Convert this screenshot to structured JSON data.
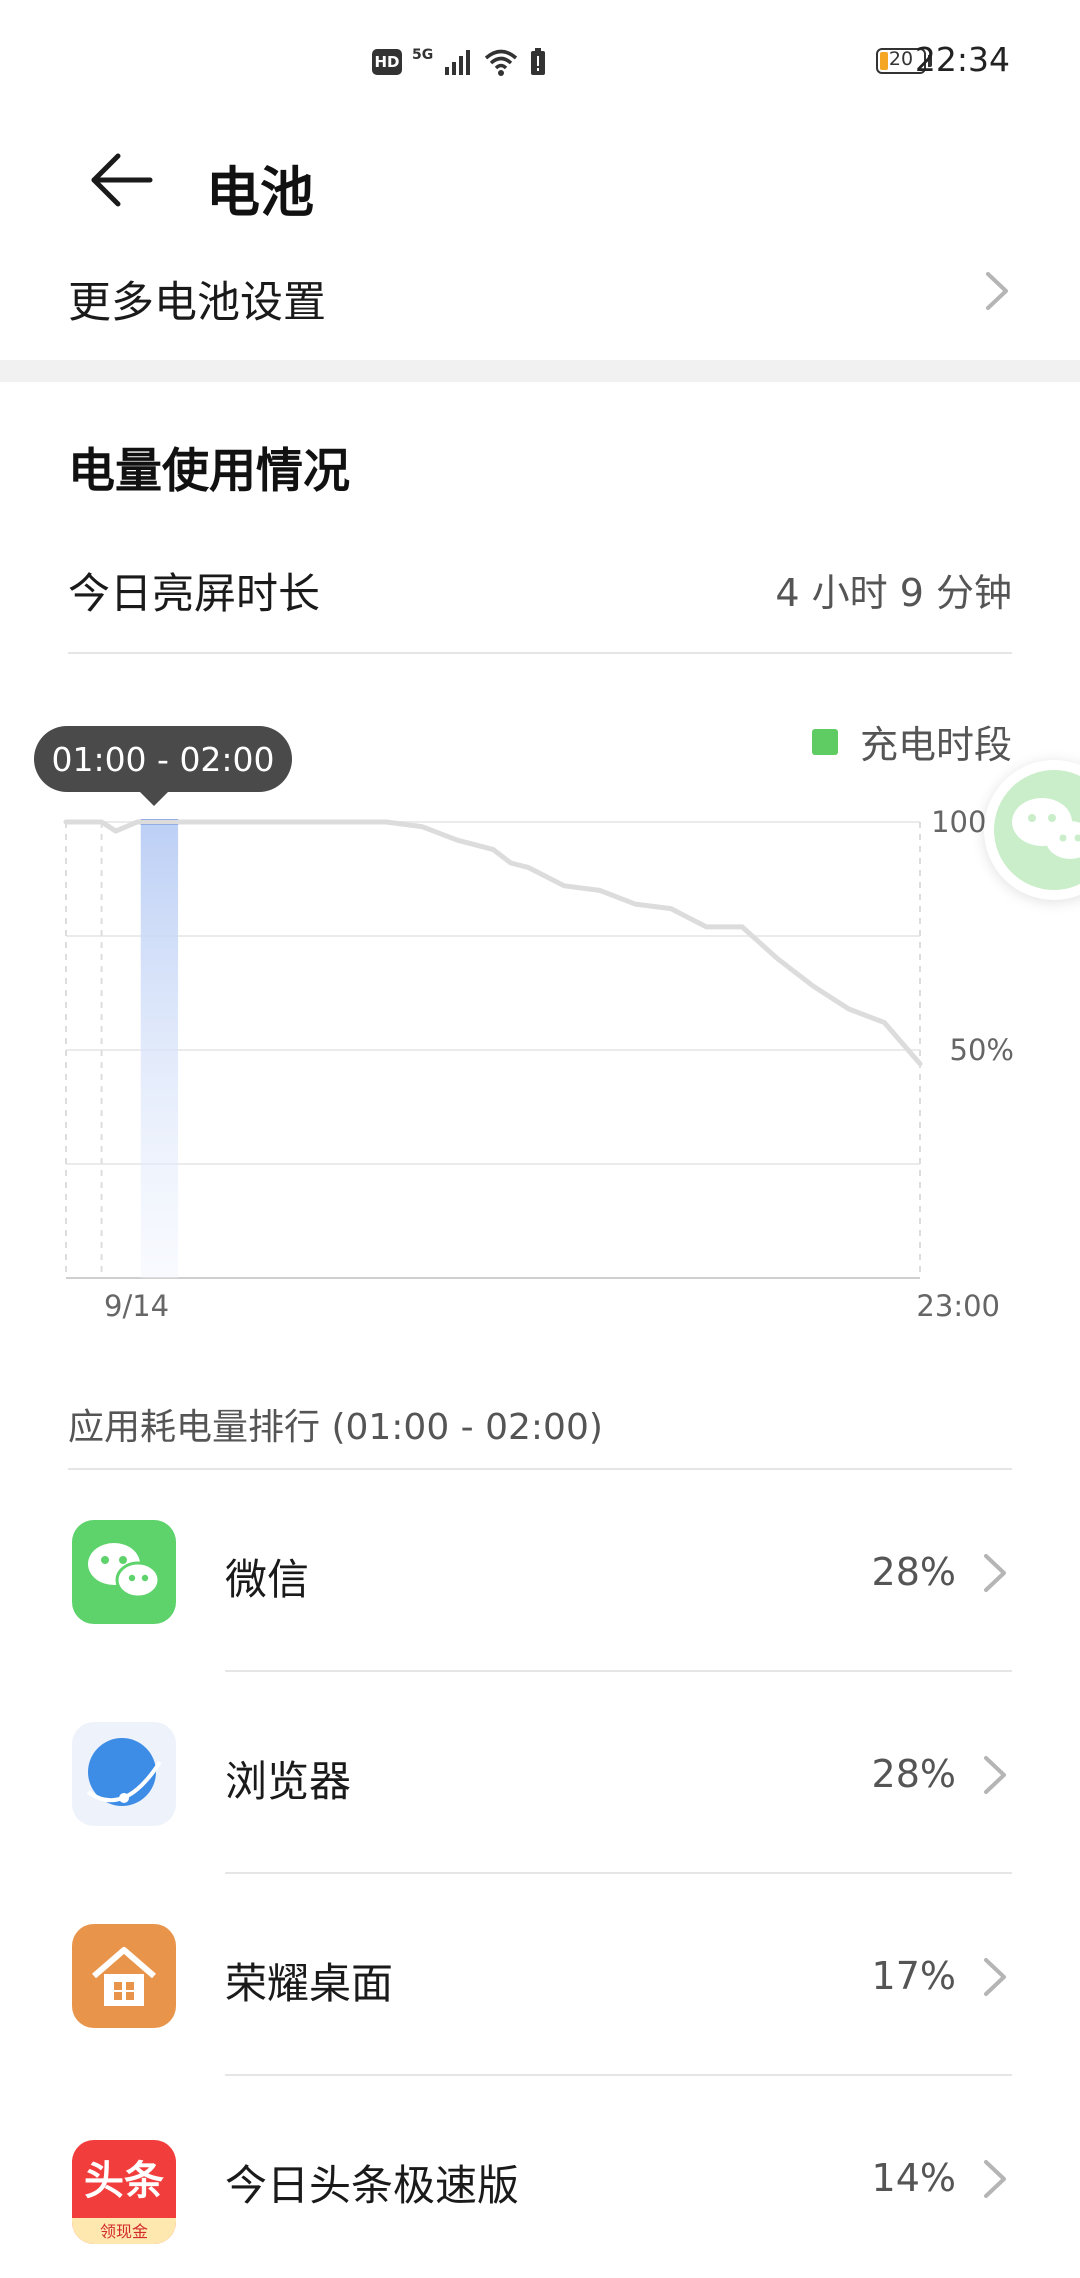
{
  "status_bar": {
    "hd": "HD",
    "network": "5G",
    "battery_level": "20",
    "time": "22:34"
  },
  "header": {
    "title": "电池"
  },
  "more_settings": {
    "label": "更多电池设置"
  },
  "usage_section": {
    "title": "电量使用情况",
    "screen_time_label": "今日亮屏时长",
    "screen_time_value": "4 小时 9 分钟"
  },
  "chart": {
    "legend_label": "充电时段",
    "legend_color": "#5fcc63",
    "tooltip": "01:00 - 02:00",
    "y_tick_100": "100%",
    "y_tick_50": "50%",
    "x_start": "9/14",
    "x_end": "23:00"
  },
  "chart_data": {
    "type": "line",
    "x_labels": [
      "9/14",
      "23:00"
    ],
    "y_ticks": [
      "100%",
      "50%"
    ],
    "ylim": [
      0,
      100
    ],
    "grid": true,
    "legend": [
      {
        "name": "充电时段",
        "color": "#5fcc63"
      }
    ],
    "highlight": {
      "label": "01:00 - 02:00",
      "color": "#4a7bec"
    },
    "series": [
      {
        "x": [
          0,
          1,
          1.4,
          2,
          3,
          4,
          5,
          6,
          7,
          8,
          8.5,
          9,
          10,
          11,
          12,
          12.5,
          13,
          14,
          15,
          16,
          17,
          17.5,
          18,
          19,
          20,
          21,
          22,
          23,
          24
        ],
        "values": [
          100,
          100,
          98,
          100,
          100,
          100,
          100,
          100,
          100,
          100,
          100,
          100,
          99,
          96,
          94,
          91,
          90,
          86,
          85,
          82,
          81,
          79,
          77,
          77,
          70,
          64,
          59,
          56,
          47
        ]
      }
    ]
  },
  "ranking": {
    "header": "应用耗电量排行 (01:00 - 02:00)",
    "apps": [
      {
        "name": "微信",
        "pct": "28%",
        "icon": "wechat-icon"
      },
      {
        "name": "浏览器",
        "pct": "28%",
        "icon": "browser-icon"
      },
      {
        "name": "荣耀桌面",
        "pct": "17%",
        "icon": "launcher-icon"
      },
      {
        "name": "今日头条极速版",
        "pct": "14%",
        "icon": "toutiao-icon",
        "icon_text": "头条",
        "icon_subtext": "领现金"
      }
    ]
  }
}
